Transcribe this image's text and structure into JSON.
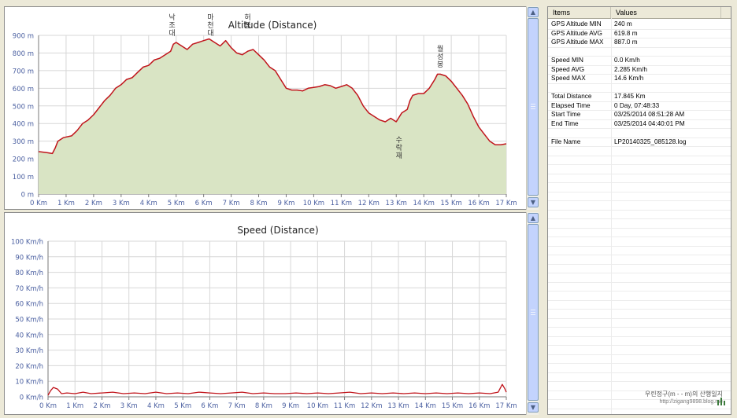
{
  "altitude_chart": {
    "title": "Altitude (Distance)",
    "line_color": "#c0141b",
    "fill_color": "#d9e4c4",
    "chart_data": {
      "type": "area",
      "title": "Altitude (Distance)",
      "xlim": [
        0,
        17
      ],
      "ylim": [
        0,
        900
      ],
      "x_ticks": [
        "0 Km",
        "1 Km",
        "2 Km",
        "3 Km",
        "4 Km",
        "5 Km",
        "6 Km",
        "7 Km",
        "8 Km",
        "9 Km",
        "10 Km",
        "11 Km",
        "12 Km",
        "13 Km",
        "14 Km",
        "15 Km",
        "16 Km",
        "17 Km"
      ],
      "y_ticks": [
        "0 m",
        "100 m",
        "200 m",
        "300 m",
        "400 m",
        "500 m",
        "600 m",
        "700 m",
        "800 m",
        "900 m"
      ],
      "grid": true,
      "x": [
        0,
        0.05,
        0.3,
        0.5,
        0.6,
        0.7,
        0.9,
        1.2,
        1.4,
        1.6,
        1.8,
        2.0,
        2.2,
        2.4,
        2.6,
        2.8,
        3.0,
        3.2,
        3.4,
        3.6,
        3.8,
        4.0,
        4.2,
        4.4,
        4.6,
        4.8,
        4.9,
        5.0,
        5.2,
        5.4,
        5.6,
        5.8,
        6.0,
        6.2,
        6.4,
        6.6,
        6.8,
        7.0,
        7.2,
        7.4,
        7.6,
        7.8,
        8.0,
        8.2,
        8.4,
        8.6,
        8.8,
        9.0,
        9.2,
        9.4,
        9.6,
        9.8,
        10.0,
        10.2,
        10.4,
        10.6,
        10.8,
        11.0,
        11.2,
        11.4,
        11.6,
        11.8,
        12.0,
        12.2,
        12.4,
        12.6,
        12.8,
        13.0,
        13.2,
        13.4,
        13.5,
        13.6,
        13.8,
        14.0,
        14.2,
        14.4,
        14.5,
        14.6,
        14.8,
        15.0,
        15.2,
        15.4,
        15.6,
        15.8,
        16.0,
        16.2,
        16.4,
        16.6,
        16.8,
        17.0
      ],
      "y": [
        240,
        240,
        235,
        230,
        260,
        300,
        320,
        330,
        360,
        400,
        420,
        450,
        490,
        530,
        560,
        600,
        620,
        650,
        660,
        690,
        720,
        730,
        760,
        770,
        790,
        810,
        850,
        860,
        840,
        820,
        850,
        860,
        870,
        880,
        860,
        840,
        870,
        830,
        800,
        790,
        810,
        820,
        790,
        760,
        720,
        700,
        650,
        600,
        590,
        590,
        585,
        600,
        605,
        610,
        620,
        615,
        600,
        610,
        620,
        600,
        560,
        500,
        460,
        440,
        420,
        410,
        430,
        410,
        460,
        480,
        530,
        560,
        570,
        570,
        600,
        650,
        680,
        680,
        670,
        640,
        600,
        560,
        510,
        440,
        380,
        340,
        300,
        280,
        280,
        285
      ],
      "annotations": [
        {
          "text": "낙조대",
          "x": 4.85
        },
        {
          "text": "마천대",
          "x": 6.25
        },
        {
          "text": "허봉",
          "x": 7.6
        },
        {
          "text": "수락재",
          "x": 13.1
        },
        {
          "text": "월성봉",
          "x": 14.6
        }
      ]
    }
  },
  "speed_chart": {
    "title": "Speed (Distance)",
    "line_color": "#c0141b",
    "chart_data": {
      "type": "line",
      "title": "Speed (Distance)",
      "xlim": [
        0,
        17
      ],
      "ylim": [
        0,
        100
      ],
      "x_ticks": [
        "0 Km",
        "1 Km",
        "2 Km",
        "3 Km",
        "4 Km",
        "5 Km",
        "6 Km",
        "7 Km",
        "8 Km",
        "9 Km",
        "10 Km",
        "11 Km",
        "12 Km",
        "13 Km",
        "14 Km",
        "15 Km",
        "16 Km",
        "17 Km"
      ],
      "y_ticks": [
        "0 Km/h",
        "10 Km/h",
        "20 Km/h",
        "30 Km/h",
        "40 Km/h",
        "50 Km/h",
        "60 Km/h",
        "70 Km/h",
        "80 Km/h",
        "90 Km/h",
        "100 Km/h"
      ],
      "grid": true,
      "x": [
        0,
        0.1,
        0.2,
        0.35,
        0.5,
        0.7,
        1.0,
        1.3,
        1.6,
        2.0,
        2.4,
        2.8,
        3.2,
        3.6,
        4.0,
        4.4,
        4.8,
        5.2,
        5.6,
        6.0,
        6.4,
        6.8,
        7.2,
        7.6,
        8.0,
        8.4,
        8.8,
        9.2,
        9.6,
        10.0,
        10.4,
        10.8,
        11.2,
        11.6,
        12.0,
        12.4,
        12.8,
        13.2,
        13.6,
        14.0,
        14.4,
        14.8,
        15.2,
        15.6,
        16.0,
        16.4,
        16.7,
        16.85,
        16.95,
        17.0
      ],
      "y": [
        1,
        4,
        6,
        5,
        2,
        2.5,
        2,
        3,
        2,
        2.5,
        3,
        2,
        2.5,
        2,
        3,
        2,
        2.5,
        2,
        3,
        2.5,
        2,
        2.5,
        3,
        2,
        2.5,
        2,
        2,
        2.5,
        2,
        2.5,
        2,
        2.5,
        3,
        2,
        2.5,
        2,
        2.5,
        2,
        2.5,
        2,
        2.5,
        2,
        2.5,
        2,
        2.5,
        2,
        3,
        8,
        5,
        3
      ]
    }
  },
  "stats_table": {
    "col_items": "Items",
    "col_values": "Values",
    "rows": [
      {
        "item": "GPS Altitude MIN",
        "value": "240 m"
      },
      {
        "item": "GPS Altitude AVG",
        "value": "619.8 m"
      },
      {
        "item": "GPS Altitude MAX",
        "value": "887.0 m"
      },
      {
        "item": "",
        "value": ""
      },
      {
        "item": "Speed MIN",
        "value": "0.0 Km/h"
      },
      {
        "item": "Speed AVG",
        "value": "2.285 Km/h"
      },
      {
        "item": "Speed MAX",
        "value": "14.6 Km/h"
      },
      {
        "item": "",
        "value": ""
      },
      {
        "item": "Total Distance",
        "value": "17.845 Km"
      },
      {
        "item": "Elapsed Time",
        "value": "0 Day, 07:48:33"
      },
      {
        "item": "Start Time",
        "value": "03/25/2014 08:51:28 AM"
      },
      {
        "item": "End Time",
        "value": "03/25/2014 04:40:01 PM"
      },
      {
        "item": "",
        "value": ""
      },
      {
        "item": "File Name",
        "value": "LP20140325_085128.log"
      }
    ]
  },
  "watermark": {
    "line1": "우린정구(m - - m)의 산행일지",
    "line2": "http://zigang9898.blog.me"
  }
}
